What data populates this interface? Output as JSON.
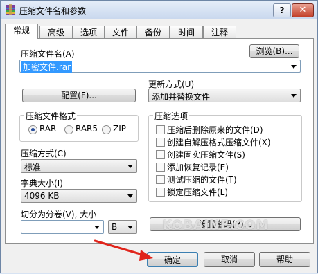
{
  "window": {
    "title": "压缩文件名和参数"
  },
  "titlebar": {
    "help": "?",
    "close": "✕"
  },
  "tabs": [
    "常规",
    "高级",
    "选项",
    "文件",
    "备份",
    "时间",
    "注释"
  ],
  "general": {
    "archive_name_label": "压缩文件名(A)",
    "browse_button": "浏览(B)...",
    "archive_name_value": "加密文件.rar",
    "update_mode_label": "更新方式(U)",
    "update_mode_value": "添加并替换文件",
    "profiles_button": "配置(F)...",
    "format_group_title": "压缩文件格式",
    "formats": [
      "RAR",
      "RAR5",
      "ZIP"
    ],
    "options_group_title": "压缩选项",
    "options": [
      "压缩后删除原来的文件(D)",
      "创建自解压格式压缩文件(X)",
      "创建固实压缩文件(S)",
      "添加恢复记录(E)",
      "测试压缩的文件(T)",
      "锁定压缩文件(L)"
    ],
    "method_label": "压缩方式(C)",
    "method_value": "标准",
    "dict_label": "字典大小(I)",
    "dict_value": "4096 KB",
    "split_label": "切分为分卷(V), 大小",
    "split_value": "",
    "split_unit": "B",
    "password_button": "设置密码(P)..."
  },
  "buttons": {
    "ok": "确定",
    "cancel": "取消",
    "help": "帮助"
  },
  "watermark": "KOBAINE.COM",
  "colors": {
    "selection": "#3399ff",
    "arrow": "#e0241b",
    "close": "#c2402a"
  }
}
